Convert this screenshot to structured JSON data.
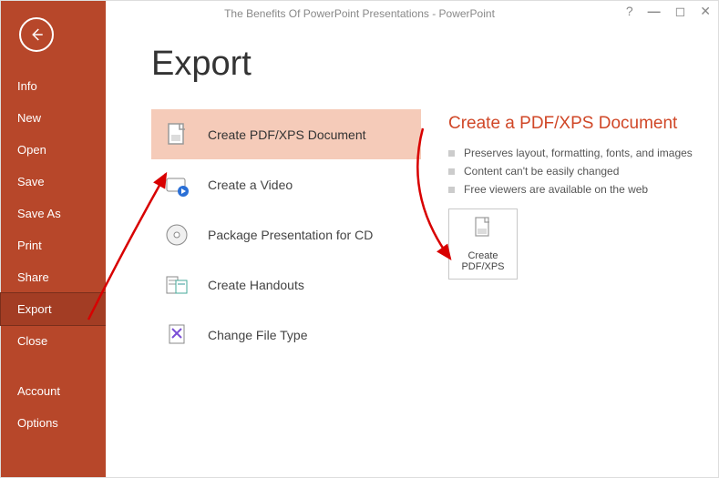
{
  "window": {
    "title": "The Benefits Of PowerPoint Presentations - PowerPoint"
  },
  "sidebar": {
    "items": [
      {
        "label": "Info"
      },
      {
        "label": "New"
      },
      {
        "label": "Open"
      },
      {
        "label": "Save"
      },
      {
        "label": "Save As"
      },
      {
        "label": "Print"
      },
      {
        "label": "Share"
      },
      {
        "label": "Export"
      },
      {
        "label": "Close"
      }
    ],
    "bottom_items": [
      {
        "label": "Account"
      },
      {
        "label": "Options"
      }
    ]
  },
  "main": {
    "title": "Export",
    "options": [
      {
        "label": "Create PDF/XPS Document"
      },
      {
        "label": "Create a Video"
      },
      {
        "label": "Package Presentation for CD"
      },
      {
        "label": "Create Handouts"
      },
      {
        "label": "Change File Type"
      }
    ],
    "details": {
      "title": "Create a PDF/XPS Document",
      "bullets": [
        "Preserves layout, formatting, fonts, and images",
        "Content can't be easily changed",
        "Free viewers are available on the web"
      ],
      "button_label_1": "Create",
      "button_label_2": "PDF/XPS"
    }
  }
}
